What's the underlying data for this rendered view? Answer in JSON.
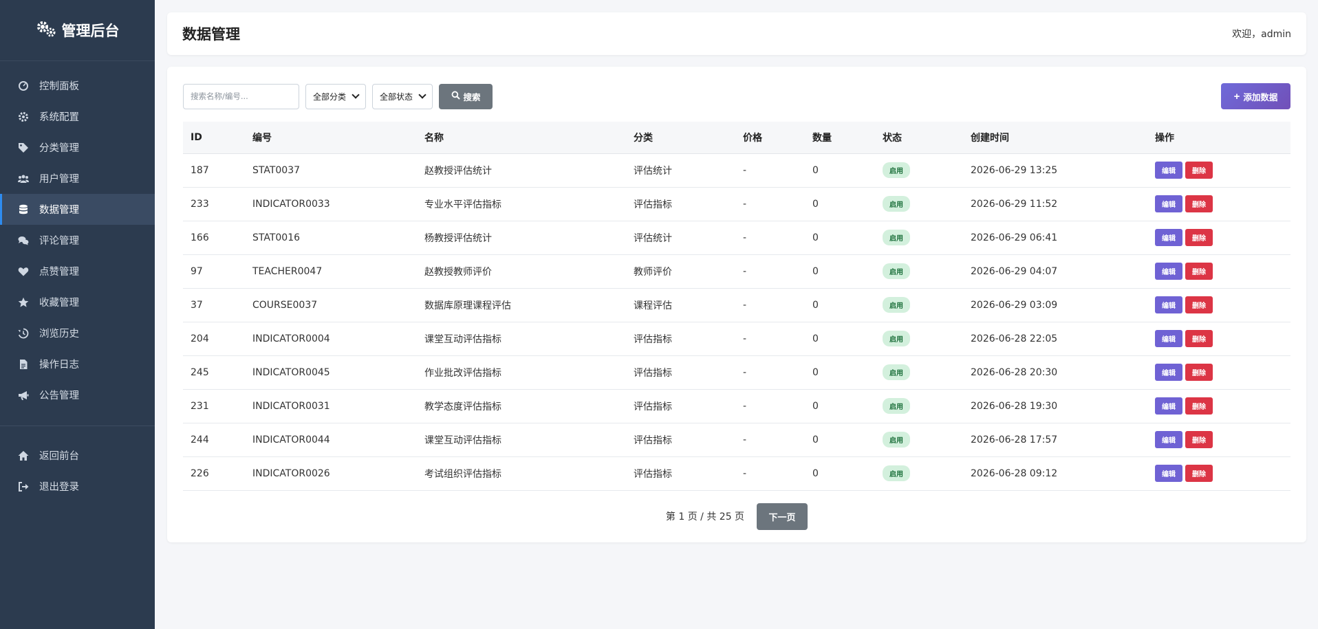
{
  "brand": {
    "title": "管理后台",
    "icon": "gears-icon"
  },
  "sidebar": {
    "items": [
      {
        "label": "控制面板",
        "icon": "dashboard-icon",
        "active": false
      },
      {
        "label": "系统配置",
        "icon": "gear-icon",
        "active": false
      },
      {
        "label": "分类管理",
        "icon": "tags-icon",
        "active": false
      },
      {
        "label": "用户管理",
        "icon": "users-icon",
        "active": false
      },
      {
        "label": "数据管理",
        "icon": "database-icon",
        "active": true
      },
      {
        "label": "评论管理",
        "icon": "comments-icon",
        "active": false
      },
      {
        "label": "点赞管理",
        "icon": "heart-icon",
        "active": false
      },
      {
        "label": "收藏管理",
        "icon": "star-icon",
        "active": false
      },
      {
        "label": "浏览历史",
        "icon": "history-icon",
        "active": false
      },
      {
        "label": "操作日志",
        "icon": "file-icon",
        "active": false
      },
      {
        "label": "公告管理",
        "icon": "bullhorn-icon",
        "active": false
      }
    ],
    "bottom": [
      {
        "label": "返回前台",
        "icon": "home-icon"
      },
      {
        "label": "退出登录",
        "icon": "sign-out-icon"
      }
    ]
  },
  "header": {
    "title": "数据管理",
    "welcome": "欢迎，admin"
  },
  "toolbar": {
    "search_placeholder": "搜索名称/编号...",
    "category_select": "全部分类",
    "status_select": "全部状态",
    "search_label": "搜索",
    "add_label": "添加数据"
  },
  "table": {
    "columns": [
      "ID",
      "编号",
      "名称",
      "分类",
      "价格",
      "数量",
      "状态",
      "创建时间",
      "操作"
    ],
    "edit_label": "编辑",
    "delete_label": "删除",
    "rows": [
      {
        "id": "187",
        "code": "STAT0037",
        "name": "赵教授评估统计",
        "category": "评估统计",
        "price": "-",
        "qty": "0",
        "status": "启用",
        "created": "2026-06-29 13:25"
      },
      {
        "id": "233",
        "code": "INDICATOR0033",
        "name": "专业水平评估指标",
        "category": "评估指标",
        "price": "-",
        "qty": "0",
        "status": "启用",
        "created": "2026-06-29 11:52"
      },
      {
        "id": "166",
        "code": "STAT0016",
        "name": "杨教授评估统计",
        "category": "评估统计",
        "price": "-",
        "qty": "0",
        "status": "启用",
        "created": "2026-06-29 06:41"
      },
      {
        "id": "97",
        "code": "TEACHER0047",
        "name": "赵教授教师评价",
        "category": "教师评价",
        "price": "-",
        "qty": "0",
        "status": "启用",
        "created": "2026-06-29 04:07"
      },
      {
        "id": "37",
        "code": "COURSE0037",
        "name": "数据库原理课程评估",
        "category": "课程评估",
        "price": "-",
        "qty": "0",
        "status": "启用",
        "created": "2026-06-29 03:09"
      },
      {
        "id": "204",
        "code": "INDICATOR0004",
        "name": "课堂互动评估指标",
        "category": "评估指标",
        "price": "-",
        "qty": "0",
        "status": "启用",
        "created": "2026-06-28 22:05"
      },
      {
        "id": "245",
        "code": "INDICATOR0045",
        "name": "作业批改评估指标",
        "category": "评估指标",
        "price": "-",
        "qty": "0",
        "status": "启用",
        "created": "2026-06-28 20:30"
      },
      {
        "id": "231",
        "code": "INDICATOR0031",
        "name": "教学态度评估指标",
        "category": "评估指标",
        "price": "-",
        "qty": "0",
        "status": "启用",
        "created": "2026-06-28 19:30"
      },
      {
        "id": "244",
        "code": "INDICATOR0044",
        "name": "课堂互动评估指标",
        "category": "评估指标",
        "price": "-",
        "qty": "0",
        "status": "启用",
        "created": "2026-06-28 17:57"
      },
      {
        "id": "226",
        "code": "INDICATOR0026",
        "name": "考试组织评估指标",
        "category": "评估指标",
        "price": "-",
        "qty": "0",
        "status": "启用",
        "created": "2026-06-28 09:12"
      }
    ]
  },
  "pager": {
    "text": "第 1 页 / 共 25 页",
    "next_label": "下一页"
  },
  "colors": {
    "sidebar_bg": "#2c3b4f",
    "accent": "#2e8cf0",
    "primary_gradient": "#6f6ad9",
    "danger": "#dc3545",
    "badge_bg": "#d3f0dd"
  }
}
